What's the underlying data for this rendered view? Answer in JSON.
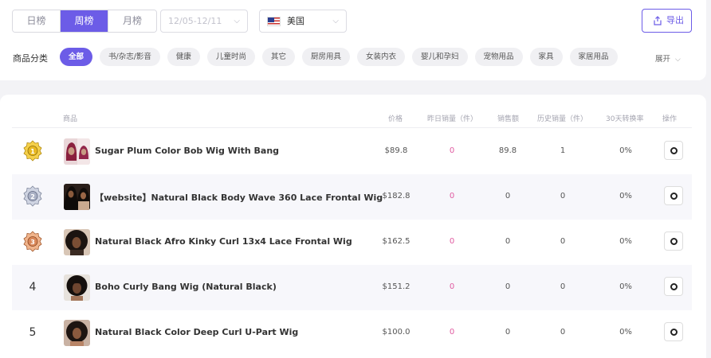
{
  "tabs": [
    {
      "label": "日榜",
      "active": false
    },
    {
      "label": "周榜",
      "active": true
    },
    {
      "label": "月榜",
      "active": false
    }
  ],
  "date_range": {
    "value": "12/05-12/11"
  },
  "country": {
    "label": "美国"
  },
  "export": {
    "label": "导出"
  },
  "category": {
    "label": "商品分类",
    "items": [
      "全部",
      "书/杂志/影音",
      "健康",
      "儿童时尚",
      "其它",
      "厨房用具",
      "女装内衣",
      "婴儿和孕妇",
      "宠物用品",
      "家具",
      "家居用品"
    ],
    "expand_label": "展开"
  },
  "table": {
    "headers": {
      "product": "商品",
      "price": "价格",
      "yesterday_sales": "昨日销量（件）",
      "sales_amount": "销售额",
      "history_sales": "历史销量（件）",
      "conversion": "30天转换率",
      "action": "操作"
    },
    "rows": [
      {
        "rank": "1",
        "medal": "gold",
        "name": "Sugar Plum Color Bob Wig With Bang",
        "price": "$89.8",
        "yesterday": "0",
        "amount": "89.8",
        "history": "1",
        "rate": "0%"
      },
      {
        "rank": "2",
        "medal": "silver",
        "name": "【website】Natural Black Body Wave 360 Lace Frontal Wig",
        "price": "$182.8",
        "yesterday": "0",
        "amount": "0",
        "history": "0",
        "rate": "0%"
      },
      {
        "rank": "3",
        "medal": "bronze",
        "name": "Natural Black Afro Kinky Curl 13x4 Lace Frontal Wig",
        "price": "$162.5",
        "yesterday": "0",
        "amount": "0",
        "history": "0",
        "rate": "0%"
      },
      {
        "rank": "4",
        "medal": "",
        "name": "Boho Curly Bang Wig (Natural Black)",
        "price": "$151.2",
        "yesterday": "0",
        "amount": "0",
        "history": "0",
        "rate": "0%"
      },
      {
        "rank": "5",
        "medal": "",
        "name": "Natural Black Color Deep Curl U-Part Wig",
        "price": "$100.0",
        "yesterday": "0",
        "amount": "0",
        "history": "0",
        "rate": "0%"
      }
    ]
  },
  "colors": {
    "accent": "#6c5ce7",
    "pink": "#e05aa0",
    "gold": "#e8b923",
    "silver": "#a9b0c4",
    "bronze": "#d9885a"
  }
}
